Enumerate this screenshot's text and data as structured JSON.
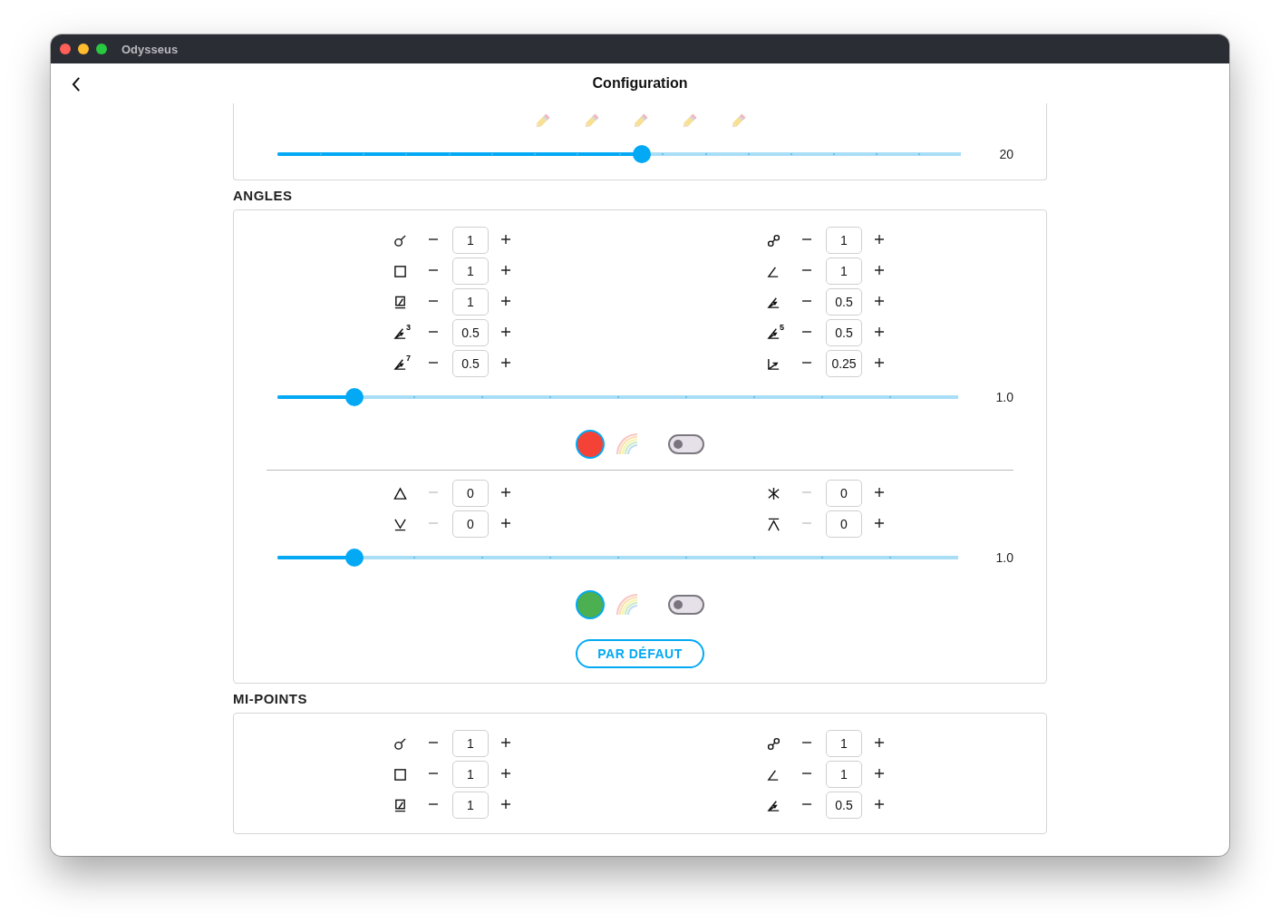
{
  "window": {
    "title": "Odysseus"
  },
  "header": {
    "title": "Configuration"
  },
  "top_card": {
    "slider": {
      "level": 0.533,
      "reading": "20"
    }
  },
  "sections": [
    {
      "title": "ANGLES",
      "groups": [
        {
          "left": [
            {
              "kind": "conjunction",
              "value": "1",
              "minus_disabled": false
            },
            {
              "kind": "square",
              "value": "1",
              "minus_disabled": false
            },
            {
              "kind": "sesquiquadrate",
              "value": "1",
              "minus_disabled": false
            },
            {
              "kind": "angle-arrow",
              "sup": "3",
              "value": "0.5",
              "minus_disabled": false
            },
            {
              "kind": "angle-arrow",
              "sup": "7",
              "value": "0.5",
              "minus_disabled": false
            }
          ],
          "right": [
            {
              "kind": "opposition",
              "value": "1",
              "minus_disabled": false
            },
            {
              "kind": "angle",
              "value": "1",
              "minus_disabled": false
            },
            {
              "kind": "angle-arrow",
              "value": "0.5",
              "minus_disabled": false
            },
            {
              "kind": "angle-arrow",
              "sup": "5",
              "value": "0.5",
              "minus_disabled": false
            },
            {
              "kind": "angle-double",
              "value": "0.25",
              "minus_disabled": false
            }
          ],
          "slider": {
            "level": 0.113,
            "reading": "1.0"
          },
          "color": "#f44336",
          "toggle_on": false
        },
        {
          "left": [
            {
              "kind": "trine",
              "value": "0",
              "minus_disabled": true
            },
            {
              "kind": "semisextile",
              "value": "0",
              "minus_disabled": true
            }
          ],
          "right": [
            {
              "kind": "sextile",
              "value": "0",
              "minus_disabled": true
            },
            {
              "kind": "quincunx",
              "value": "0",
              "minus_disabled": true
            }
          ],
          "slider": {
            "level": 0.113,
            "reading": "1.0"
          },
          "color": "#4caf50",
          "toggle_on": false
        }
      ],
      "default_button": "PAR DÉFAUT"
    },
    {
      "title": "MI-POINTS",
      "groups": [
        {
          "left": [
            {
              "kind": "conjunction",
              "value": "1",
              "minus_disabled": false
            },
            {
              "kind": "square",
              "value": "1",
              "minus_disabled": false
            },
            {
              "kind": "sesquiquadrate",
              "value": "1",
              "minus_disabled": false
            }
          ],
          "right": [
            {
              "kind": "opposition",
              "value": "1",
              "minus_disabled": false
            },
            {
              "kind": "angle",
              "value": "1",
              "minus_disabled": false
            },
            {
              "kind": "angle-arrow",
              "value": "0.5",
              "minus_disabled": false
            }
          ]
        }
      ]
    }
  ]
}
